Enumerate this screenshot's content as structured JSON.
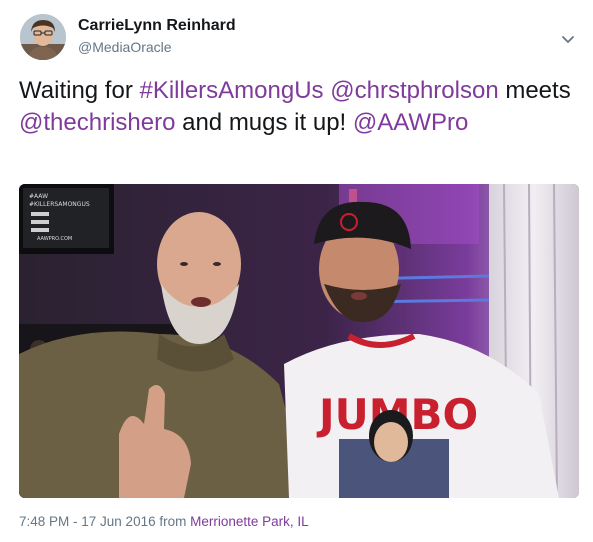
{
  "author": {
    "display_name": "CarrieLynn Reinhard",
    "handle": "@MediaOracle"
  },
  "tweet": {
    "part1": "Waiting for ",
    "hashtag": "#KillersAmongUs",
    "space1": " ",
    "mention1": "@chrstphrolson",
    "part2": " meets ",
    "mention2": "@thechrishero",
    "part3": " and mugs it up! ",
    "mention3": "@AAWPro"
  },
  "photo": {
    "screen_text": [
      "#AAW",
      "#KILLERSAMONGUS",
      "AAWPRO.COM"
    ],
    "shirt_text": "JUMBO"
  },
  "meta": {
    "timestamp": "7:48 PM - 17 Jun 2016",
    "from_label": " from ",
    "location": "Merrionette Park, IL"
  },
  "colors": {
    "link": "#7e3b9c",
    "secondary_text": "#657786",
    "primary_text": "#14171a"
  },
  "icons": {
    "caret": "chevron-down-icon"
  }
}
